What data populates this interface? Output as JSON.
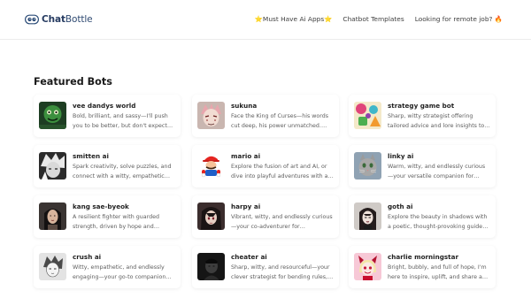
{
  "header": {
    "logo": {
      "part1": "Chat",
      "part2": "Bottle",
      "icon": "chatbottle-logo-icon"
    },
    "nav": [
      {
        "label": "⭐Must Have Ai Apps⭐"
      },
      {
        "label": "Chatbot Templates"
      },
      {
        "label": "Looking for remote job? 🔥"
      }
    ]
  },
  "section": {
    "title": "Featured Bots"
  },
  "bots": [
    {
      "name": "vee dandys world",
      "desc": "Bold, brilliant, and sassy—I'll push you to be better, but don't expect me to…",
      "avatar": "green-monster-avatar"
    },
    {
      "name": "sukuna",
      "desc": "Face the King of Curses—his words cut deep, his power unmatched. Test you…",
      "avatar": "anime-sukuna-avatar"
    },
    {
      "name": "strategy game bot",
      "desc": "Sharp, witty strategist offering tailored advice and lore insights to dominate…",
      "avatar": "colorful-game-avatar"
    },
    {
      "name": "smitten ai",
      "desc": "Spark creativity, solve puzzles, and connect with a witty, empathetic…",
      "avatar": "monochrome-anime-avatar"
    },
    {
      "name": "mario ai",
      "desc": "Explore the fusion of art and AI, or dive into playful adventures with a curiou…",
      "avatar": "mario-avatar"
    },
    {
      "name": "linky ai",
      "desc": "Warm, witty, and endlessly curious—your versatile companion for playful…",
      "avatar": "cat-avatar"
    },
    {
      "name": "kang sae-byeok",
      "desc": "A resilient fighter with guarded strength, driven by hope and loyalty,…",
      "avatar": "dark-hair-portrait-avatar"
    },
    {
      "name": "harpy ai",
      "desc": "Vibrant, witty, and endlessly curious—your co-adventurer for immersive…",
      "avatar": "dark-anime-girl-avatar"
    },
    {
      "name": "goth ai",
      "desc": "Explore the beauty in shadows with a poetic, thought-provoking guide who…",
      "avatar": "goth-girl-avatar"
    },
    {
      "name": "crush ai",
      "desc": "Witty, empathetic, and endlessly engaging—your go-to companion for…",
      "avatar": "sketch-anime-avatar"
    },
    {
      "name": "cheater ai",
      "desc": "Sharp, witty, and resourceful—your clever strategist for bending rules,…",
      "avatar": "dark-photo-avatar"
    },
    {
      "name": "charlie morningstar",
      "desc": "Bright, bubbly, and full of hope, I'm here to inspire, uplift, and share a lov…",
      "avatar": "pink-demon-avatar"
    }
  ]
}
